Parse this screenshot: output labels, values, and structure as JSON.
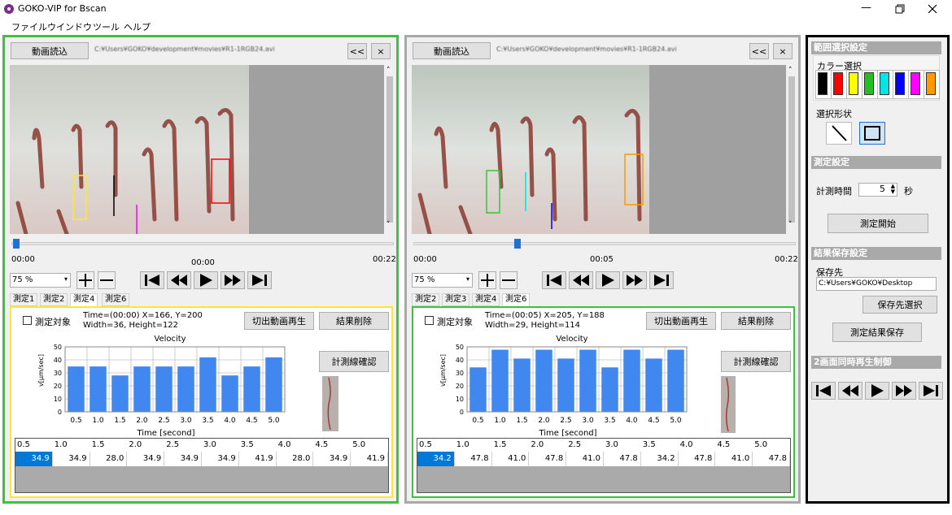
{
  "window": {
    "title": "GOKO-VIP for Bscan"
  },
  "menu": [
    "ファイル",
    "ウインドウ",
    "ツール",
    "ヘルプ"
  ],
  "left": {
    "load_label": "動画読込",
    "path": "C:¥Users¥GOKO¥development¥movies¥R1-1RGB24.avi",
    "back": "<<",
    "close": "×",
    "time_start": "00:00",
    "time_mid": "00:00",
    "time_end": "00:22",
    "zoom": "75 %",
    "tabs": [
      "測定1",
      "測定2",
      "測定4",
      "測定6"
    ],
    "active_tab": 2,
    "target_label": "測定対象",
    "info": "Time=(00:00) X=166, Y=200 Width=36, Height=122",
    "play_clip": "切出動画再生",
    "delete": "結果削除",
    "confirm": "計測線確認",
    "chart_title": "Velocity",
    "ylabel": "v[μm/sec]",
    "xlabel": "Time [second]",
    "values": [
      34.9,
      34.9,
      28.0,
      34.9,
      34.9,
      34.9,
      41.9,
      28.0,
      34.9,
      41.9
    ],
    "values_text": [
      "34.9",
      "34.9",
      "28.0",
      "34.9",
      "34.9",
      "34.9",
      "41.9",
      "28.0",
      "34.9",
      "41.9"
    ],
    "color": "#ffe633"
  },
  "right": {
    "load_label": "動画読込",
    "path": "C:¥Users¥GOKO¥development¥movies¥R1-1RGB24.avi",
    "back": "<<",
    "close": "×",
    "time_start": "00:00",
    "time_mid": "00:05",
    "time_end": "00:22",
    "zoom": "75 %",
    "tabs": [
      "測定2",
      "測定3",
      "測定4",
      "測定6"
    ],
    "active_tab": 3,
    "target_label": "測定対象",
    "info": "Time=(00:05) X=205, Y=188 Width=29, Height=114",
    "play_clip": "切出動画再生",
    "delete": "結果削除",
    "confirm": "計測線確認",
    "chart_title": "Velocity",
    "ylabel": "v[μm/sec]",
    "xlabel": "Time [second]",
    "values": [
      34.2,
      47.8,
      41.0,
      47.8,
      41.0,
      47.8,
      34.2,
      47.8,
      41.0,
      47.8
    ],
    "values_text": [
      "34.2",
      "47.8",
      "41.0",
      "47.8",
      "41.0",
      "47.8",
      "34.2",
      "47.8",
      "41.0",
      "47.8"
    ],
    "color": "#3cc23c"
  },
  "chart_data": [
    {
      "type": "bar",
      "title": "Velocity",
      "xlabel": "Time [second]",
      "ylabel": "v[μm/sec]",
      "categories": [
        "0.5",
        "1.0",
        "1.5",
        "2.0",
        "2.5",
        "3.0",
        "3.5",
        "4.0",
        "4.5",
        "5.0"
      ],
      "values": [
        34.9,
        34.9,
        28.0,
        34.9,
        34.9,
        34.9,
        41.9,
        28.0,
        34.9,
        41.9
      ],
      "ylim": [
        0,
        50
      ],
      "yticks": [
        "0",
        "10",
        "20",
        "30",
        "40",
        "50"
      ],
      "grid": true,
      "bar_color": "#4187f0"
    },
    {
      "type": "bar",
      "title": "Velocity",
      "xlabel": "Time [second]",
      "ylabel": "v[μm/sec]",
      "categories": [
        "0.5",
        "1.0",
        "1.5",
        "2.0",
        "2.5",
        "3.0",
        "3.5",
        "4.0",
        "4.5",
        "5.0"
      ],
      "values": [
        34.2,
        47.8,
        41.0,
        47.8,
        41.0,
        47.8,
        34.2,
        47.8,
        41.0,
        47.8
      ],
      "ylim": [
        0,
        50
      ],
      "yticks": [
        "0",
        "10",
        "20",
        "30",
        "40",
        "50"
      ],
      "grid": true,
      "bar_color": "#4187f0"
    }
  ],
  "time_cols": [
    "0.5",
    "1.0",
    "1.5",
    "2.0",
    "2.5",
    "3.0",
    "3.5",
    "4.0",
    "4.5",
    "5.0"
  ],
  "side": {
    "range_title": "範囲選択設定",
    "color_label": "カラー選択",
    "colors": [
      "#000000",
      "#ff0000",
      "#ffff00",
      "#22c022",
      "#00e5e5",
      "#0000ff",
      "#ff00ff",
      "#ff9900"
    ],
    "shape_label": "選択形状",
    "measure_title": "測定設定",
    "measure_time_label": "計測時間",
    "measure_time_value": "5",
    "sec_label": "秒",
    "start_label": "測定開始",
    "save_title": "結果保存設定",
    "dest_label": "保存先",
    "dest_path": "C:¥Users¥GOKO¥Desktop",
    "select_dest": "保存先選択",
    "save_results": "測定結果保存",
    "sync_title": "2画面同時再生制御"
  }
}
